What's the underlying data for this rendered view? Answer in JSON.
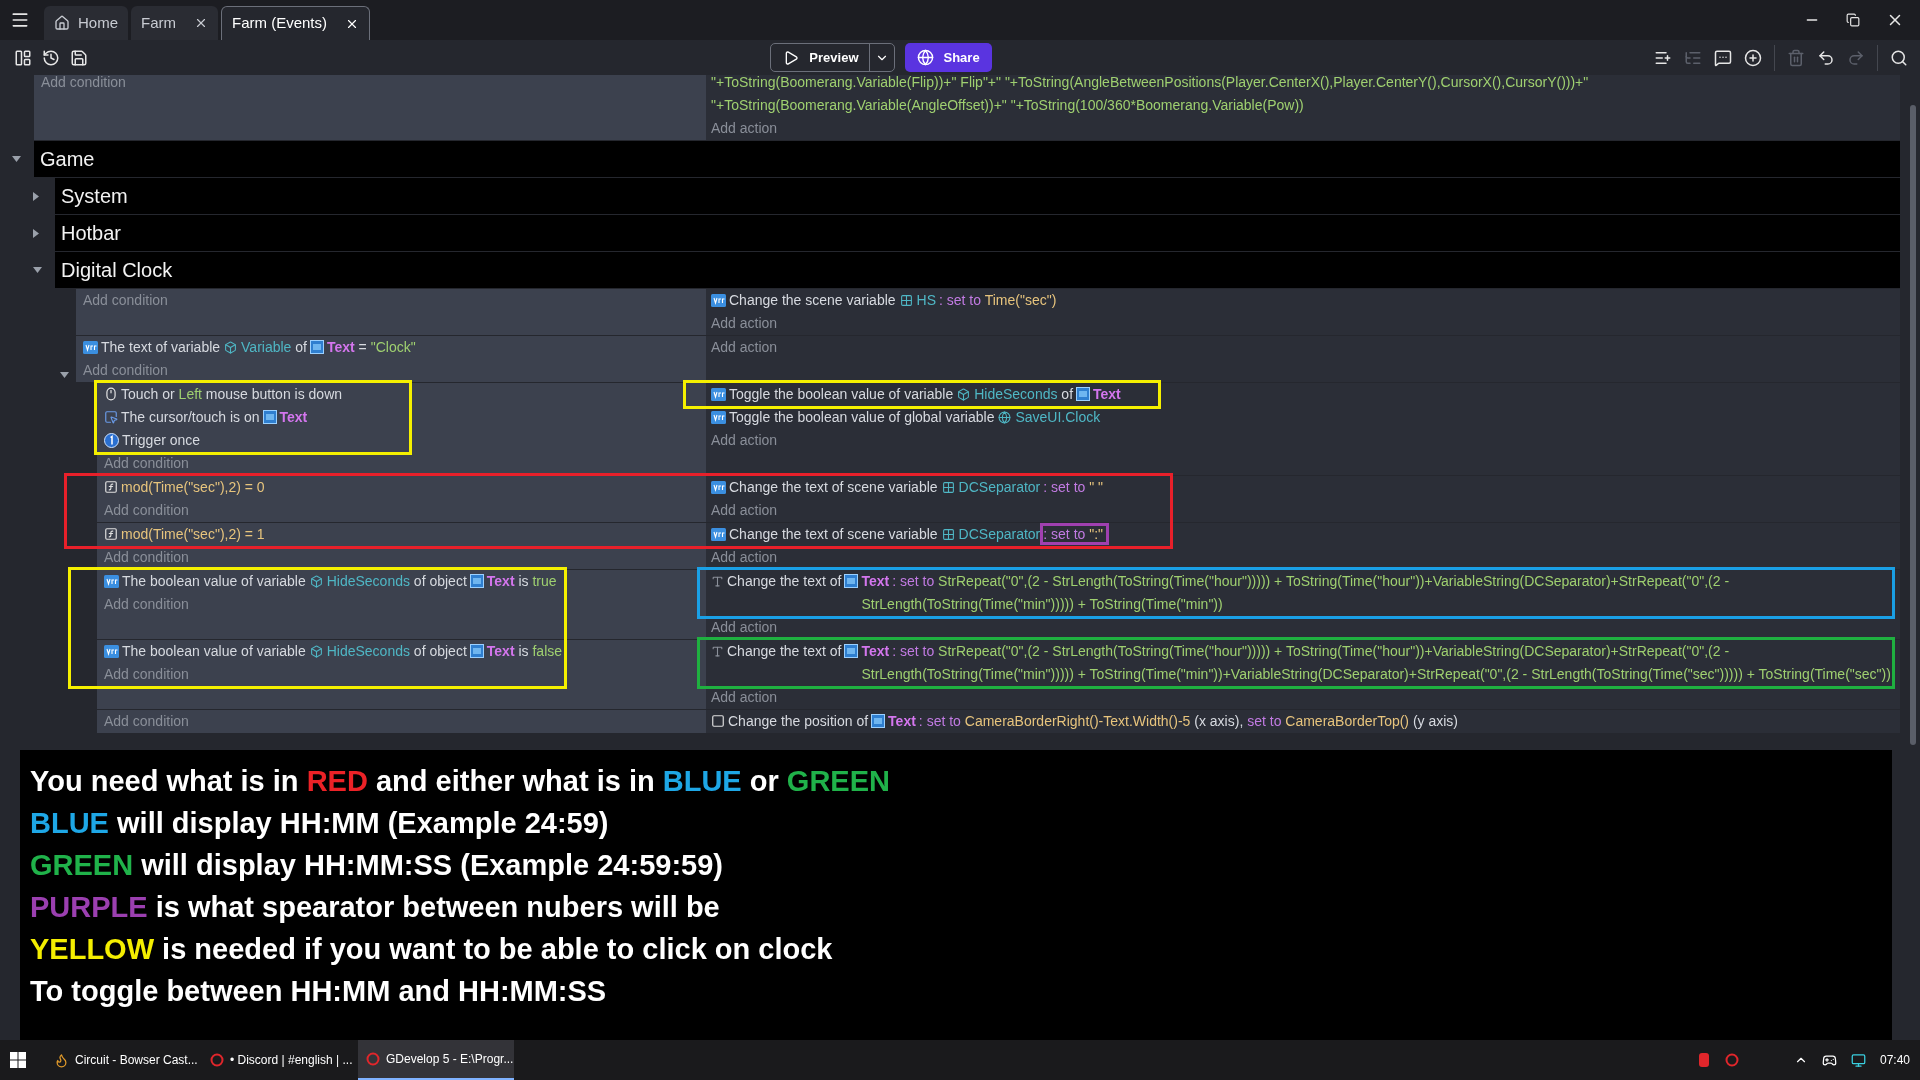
{
  "tabs": [
    {
      "kind": "home",
      "label": "Home",
      "selected": false
    },
    {
      "kind": "editor",
      "label": "Farm",
      "selected": false
    },
    {
      "kind": "editor",
      "label": "Farm (Events)",
      "selected": true
    }
  ],
  "toolbar": {
    "preview": "Preview",
    "share": "Share",
    "tools": [
      {
        "kind": "event",
        "disabled": false
      },
      {
        "kind": "subevent",
        "disabled": true
      },
      {
        "kind": "comment",
        "disabled": false
      },
      {
        "kind": "add",
        "disabled": false
      },
      {
        "kind": "delete",
        "disabled": true
      },
      {
        "kind": "undo",
        "disabled": false
      },
      {
        "kind": "redo",
        "disabled": true
      },
      {
        "kind": "search",
        "disabled": false
      }
    ]
  },
  "events": [
    {
      "kind": "event",
      "conditions": [
        {
          "kind": "add",
          "text": "Add condition"
        }
      ],
      "actions": [
        {
          "kind": "continuation",
          "parts": [
            {
              "kind": "string",
              "text": "\"+ToString(Boomerang.Variable(Flip))+\" Flip\"+\" \"+ToString(AngleBetweenPositions(Player.CenterX(),Player.CenterY(),CursorX(),CursorY()))+\""
            }
          ]
        },
        {
          "kind": "continuation",
          "parts": [
            {
              "kind": "string",
              "text": "\"+ToString(Boomerang.Variable(AngleOffset))+\" \"+ToString(100/360*Boomerang.Variable(Pow))"
            }
          ]
        },
        {
          "kind": "add",
          "text": "Add action"
        }
      ]
    },
    {
      "kind": "group",
      "title": "Game",
      "expanded": true,
      "children": [
        {
          "kind": "group",
          "title": "System",
          "expanded": false
        },
        {
          "kind": "group",
          "title": "Hotbar",
          "expanded": false
        },
        {
          "kind": "group",
          "title": "Digital Clock",
          "expanded": true,
          "children": [
            {
              "kind": "event",
              "conditions": [
                {
                  "kind": "add",
                  "text": "Add condition"
                }
              ],
              "actions": [
                {
                  "kind": "variable",
                  "parts": [
                    {
                      "kind": "plain",
                      "text": "Change the scene variable"
                    },
                    {
                      "kind": "scene",
                      "text": "HS"
                    },
                    {
                      "kind": "assign",
                      "text": ": set to"
                    },
                    {
                      "kind": "number",
                      "text": "Time(\"sec\")"
                    }
                  ]
                },
                {
                  "kind": "add",
                  "text": "Add action"
                }
              ]
            },
            {
              "kind": "event",
              "expanded": true,
              "conditions": [
                {
                  "kind": "variable",
                  "parts": [
                    {
                      "kind": "plain",
                      "text": "The text of variable"
                    },
                    {
                      "kind": "property",
                      "text": "Variable"
                    },
                    {
                      "kind": "plain",
                      "text": "of"
                    },
                    {
                      "kind": "object",
                      "text": "Text"
                    },
                    {
                      "kind": "plain",
                      "text": "="
                    },
                    {
                      "kind": "string",
                      "text": "\"Clock\""
                    }
                  ]
                },
                {
                  "kind": "add",
                  "text": "Add condition"
                }
              ],
              "actions": [
                {
                  "kind": "add",
                  "text": "Add action"
                }
              ],
              "children": [
                {
                  "kind": "event",
                  "conditions": [
                    {
                      "kind": "mouse",
                      "parts": [
                        {
                          "kind": "plain",
                          "text": "Touch or"
                        },
                        {
                          "kind": "string",
                          "text": "Left"
                        },
                        {
                          "kind": "plain",
                          "text": "mouse button is down"
                        }
                      ]
                    },
                    {
                      "kind": "cursor",
                      "parts": [
                        {
                          "kind": "plain",
                          "text": "The cursor/touch is on"
                        },
                        {
                          "kind": "object",
                          "text": "Text"
                        }
                      ]
                    },
                    {
                      "kind": "trigger",
                      "parts": [
                        {
                          "kind": "plain",
                          "text": "Trigger once"
                        }
                      ]
                    },
                    {
                      "kind": "add",
                      "text": "Add condition"
                    }
                  ],
                  "actions": [
                    {
                      "kind": "variable",
                      "parts": [
                        {
                          "kind": "plain",
                          "text": "Toggle the boolean value of variable"
                        },
                        {
                          "kind": "property",
                          "text": "HideSeconds"
                        },
                        {
                          "kind": "plain",
                          "text": "of"
                        },
                        {
                          "kind": "object",
                          "text": "Text"
                        }
                      ]
                    },
                    {
                      "kind": "variable",
                      "parts": [
                        {
                          "kind": "plain",
                          "text": "Toggle the boolean value of global variable"
                        },
                        {
                          "kind": "global",
                          "text": "SaveUI.Clock"
                        }
                      ]
                    },
                    {
                      "kind": "add",
                      "text": "Add action"
                    }
                  ]
                },
                {
                  "kind": "event",
                  "conditions": [
                    {
                      "kind": "expression",
                      "parts": [
                        {
                          "kind": "number",
                          "text": "mod(Time(\"sec\"),2)  =  0"
                        }
                      ]
                    },
                    {
                      "kind": "add",
                      "text": "Add condition"
                    }
                  ],
                  "actions": [
                    {
                      "kind": "variable",
                      "parts": [
                        {
                          "kind": "plain",
                          "text": "Change the text of scene variable"
                        },
                        {
                          "kind": "scene",
                          "text": "DCSeparator"
                        },
                        {
                          "kind": "assign",
                          "text": ": set to"
                        },
                        {
                          "kind": "number",
                          "text": "\" \""
                        }
                      ]
                    },
                    {
                      "kind": "add",
                      "text": "Add action"
                    }
                  ]
                },
                {
                  "kind": "event",
                  "conditions": [
                    {
                      "kind": "expression",
                      "parts": [
                        {
                          "kind": "number",
                          "text": "mod(Time(\"sec\"),2)  =  1"
                        }
                      ]
                    },
                    {
                      "kind": "add",
                      "text": "Add condition"
                    }
                  ],
                  "actions": [
                    {
                      "kind": "variable",
                      "parts": [
                        {
                          "kind": "plain",
                          "text": "Change the text of scene variable"
                        },
                        {
                          "kind": "scene",
                          "text": "DCSeparator"
                        },
                        {
                          "kind": "assign",
                          "text": ": set to"
                        },
                        {
                          "kind": "number",
                          "text": "\":\""
                        }
                      ]
                    },
                    {
                      "kind": "add",
                      "text": "Add action"
                    }
                  ]
                },
                {
                  "kind": "event",
                  "conditions": [
                    {
                      "kind": "variable",
                      "parts": [
                        {
                          "kind": "plain",
                          "text": "The boolean value of variable"
                        },
                        {
                          "kind": "property",
                          "text": "HideSeconds"
                        },
                        {
                          "kind": "plain",
                          "text": "of object"
                        },
                        {
                          "kind": "object",
                          "text": "Text"
                        },
                        {
                          "kind": "plain",
                          "text": "is"
                        },
                        {
                          "kind": "string",
                          "text": "true"
                        }
                      ]
                    },
                    {
                      "kind": "add",
                      "text": "Add condition"
                    }
                  ],
                  "actions": [
                    {
                      "kind": "text",
                      "parts": [
                        {
                          "kind": "plain",
                          "text": "Change the text of"
                        },
                        {
                          "kind": "object",
                          "text": "Text"
                        },
                        {
                          "kind": "assign",
                          "text": ": set to"
                        },
                        {
                          "kind": "string",
                          "text": "StrRepeat(\"0\",(2 - StrLength(ToString(Time(\"hour\"))))) + ToString(Time(\"hour\"))+VariableString(DCSeparator)+StrRepeat(\"0\",(2 - StrLength(ToString(Time(\"min\"))))) + ToString(Time(\"min\"))"
                        }
                      ]
                    },
                    {
                      "kind": "add",
                      "text": "Add action"
                    }
                  ]
                },
                {
                  "kind": "event",
                  "conditions": [
                    {
                      "kind": "variable",
                      "parts": [
                        {
                          "kind": "plain",
                          "text": "The boolean value of variable"
                        },
                        {
                          "kind": "property",
                          "text": "HideSeconds"
                        },
                        {
                          "kind": "plain",
                          "text": "of object"
                        },
                        {
                          "kind": "object",
                          "text": "Text"
                        },
                        {
                          "kind": "plain",
                          "text": "is"
                        },
                        {
                          "kind": "string",
                          "text": "false"
                        }
                      ]
                    },
                    {
                      "kind": "add",
                      "text": "Add condition"
                    }
                  ],
                  "actions": [
                    {
                      "kind": "text",
                      "parts": [
                        {
                          "kind": "plain",
                          "text": "Change the text of"
                        },
                        {
                          "kind": "object",
                          "text": "Text"
                        },
                        {
                          "kind": "assign",
                          "text": ": set to"
                        },
                        {
                          "kind": "string",
                          "text": "StrRepeat(\"0\",(2 - StrLength(ToString(Time(\"hour\"))))) + ToString(Time(\"hour\"))+VariableString(DCSeparator)+StrRepeat(\"0\",(2 - StrLength(ToString(Time(\"min\"))))) + ToString(Time(\"min\"))+VariableString(DCSeparator)+StrRepeat(\"0\",(2 - StrLength(ToString(Time(\"sec\"))))) + ToString(Time(\"sec\"))"
                        }
                      ]
                    },
                    {
                      "kind": "add",
                      "text": "Add action"
                    }
                  ]
                },
                {
                  "kind": "event",
                  "conditions": [
                    {
                      "kind": "add",
                      "text": "Add condition"
                    }
                  ],
                  "actions": [
                    {
                      "kind": "position",
                      "parts": [
                        {
                          "kind": "plain",
                          "text": "Change the position of"
                        },
                        {
                          "kind": "object",
                          "text": "Text"
                        },
                        {
                          "kind": "assign",
                          "text": ": set to"
                        },
                        {
                          "kind": "number",
                          "text": "CameraBorderRight()-Text.Width()-5"
                        },
                        {
                          "kind": "plain",
                          "text": "(x axis),"
                        },
                        {
                          "kind": "keyword",
                          "text": "set to"
                        },
                        {
                          "kind": "number",
                          "text": "CameraBorderTop()"
                        },
                        {
                          "kind": "plain",
                          "text": "(y axis)"
                        }
                      ]
                    }
                  ]
                }
              ]
            }
          ]
        }
      ]
    }
  ],
  "highlights": [
    {
      "color": "#f5f000"
    },
    {
      "color": "#f5f000"
    },
    {
      "color": "#e8202a"
    },
    {
      "color": "#a040b0"
    },
    {
      "color": "#1aa0e6"
    },
    {
      "color": "#1fb040"
    },
    {
      "color": "#f5f000"
    }
  ],
  "note": [
    [
      {
        "text": "You need what is in"
      },
      {
        "text": "RED",
        "color": "#ec2227"
      },
      {
        "text": "and either what is in"
      },
      {
        "text": "BLUE",
        "color": "#1ea7e6"
      },
      {
        "text": "or"
      },
      {
        "text": "GREEN",
        "color": "#20b24a"
      }
    ],
    [
      {
        "text": "BLUE",
        "color": "#1ea7e6"
      },
      {
        "text": "will display HH:MM (Example 24:59)"
      }
    ],
    [
      {
        "text": "GREEN",
        "color": "#20b24a"
      },
      {
        "text": "will display HH:MM:SS (Example 24:59:59)"
      }
    ],
    [
      {
        "text": "PURPLE",
        "color": "#9b3fb0"
      },
      {
        "text": "is what spearator between nubers will be"
      }
    ],
    [
      {
        "text": "YELLOW",
        "color": "#f4ee00"
      },
      {
        "text": "is needed if you want to be able to click on clock"
      }
    ],
    [
      {
        "text": "To toggle between HH:MM and HH:MM:SS"
      }
    ]
  ],
  "taskbar": {
    "items": [
      {
        "label": "Circuit - Bowser Cast...",
        "selected": false
      },
      {
        "label": "• Discord | #english | ...",
        "selected": false
      },
      {
        "label": "GDevelop 5 - E:\\Progr...",
        "selected": true
      }
    ],
    "time": "07:40"
  }
}
